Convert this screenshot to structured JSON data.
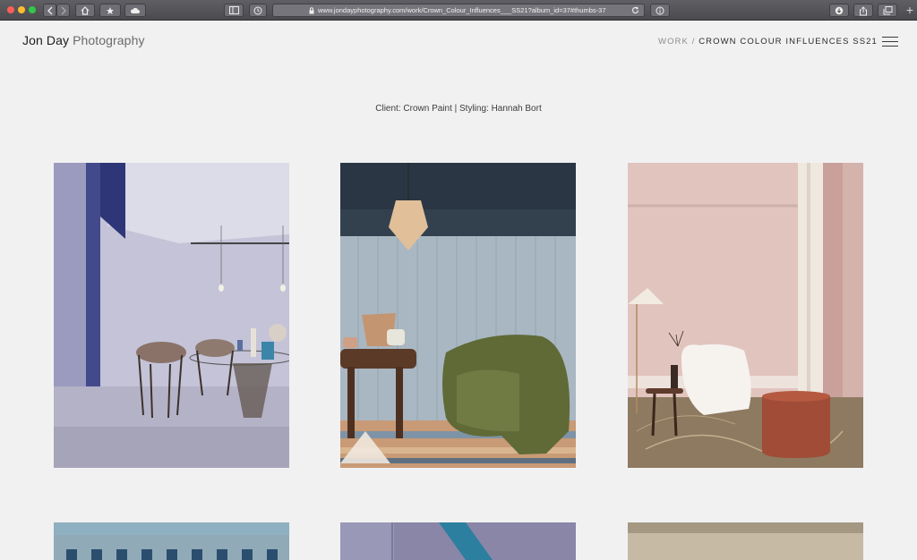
{
  "browser": {
    "url": "www.jondayphotography.com/work/Crown_Colour_Influences___SS21?album_id=37#thumbs-37",
    "new_tab_label": "+"
  },
  "site": {
    "brand_name": "Jon Day",
    "brand_suffix": "Photography",
    "breadcrumb_parent": "WORK",
    "breadcrumb_separator": "/",
    "breadcrumb_current": "CROWN COLOUR INFLUENCES SS21",
    "caption": "Client: Crown Paint | Styling: Hannah Bort"
  },
  "colors": {
    "page_bg": "#f1f1f1",
    "chrome_bg": "#55555a",
    "text_dark": "#1d1d1d",
    "text_muted": "#8d8d8d"
  },
  "gallery": {
    "columns": 3,
    "thumbnails": [
      {
        "name": "lilac-dining-room"
      },
      {
        "name": "blue-panelled-room-green-chair"
      },
      {
        "name": "pink-room-white-armchair"
      },
      {
        "name": "blue-room-partial"
      },
      {
        "name": "purple-room-partial"
      },
      {
        "name": "beige-room-partial"
      }
    ]
  },
  "icons": {
    "back": "chevron-left-icon",
    "forward": "chevron-right-icon",
    "home": "home-icon",
    "bookmarks": "star-icon",
    "cloud": "cloud-icon",
    "sidebar": "sidebar-icon",
    "history": "clock-icon",
    "reload": "reload-icon",
    "info": "info-icon",
    "download": "download-icon",
    "share": "share-icon",
    "tabs": "tabs-icon",
    "menu": "hamburger-menu-icon"
  }
}
